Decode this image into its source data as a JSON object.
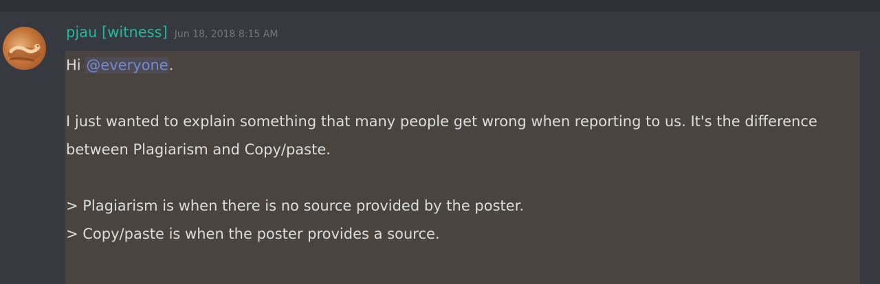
{
  "message": {
    "author": "pjau [witness]",
    "timestamp": "Jun 18, 2018 8:15 AM",
    "greeting_prefix": "Hi ",
    "mention": "@everyone",
    "greeting_suffix": ".",
    "line1": "I just wanted to explain something that many people get wrong when reporting to us. It's the difference",
    "line2": "between Plagiarism and Copy/paste.",
    "line3": "> Plagiarism is when there is no source provided by the poster.",
    "line4": "> Copy/paste is when the poster provides a source."
  },
  "colors": {
    "background": "#36393f",
    "author": "#1abc9c",
    "mention": "#7289da",
    "highlight": "#49443f",
    "text": "#dcddde"
  }
}
